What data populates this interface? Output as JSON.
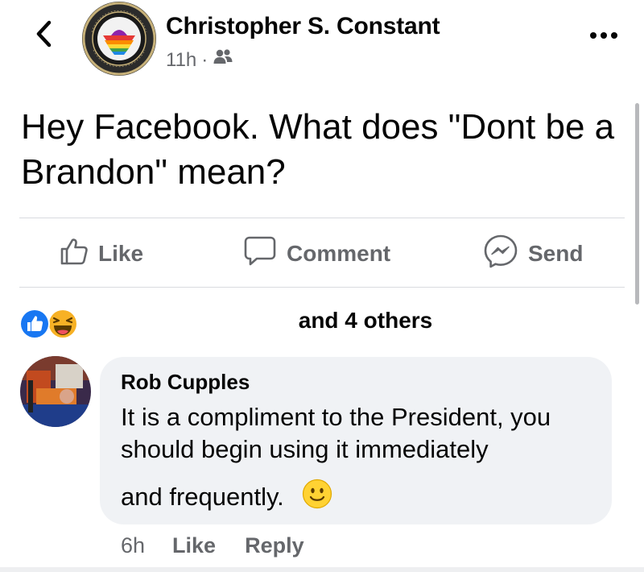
{
  "header": {
    "author": "Christopher S. Constant",
    "time": "11h",
    "separator": "·",
    "audience_icon": "friends-icon",
    "back_icon": "chevron-left-icon",
    "more_icon": "more-horizontal-icon"
  },
  "post": {
    "text": "Hey Facebook. What does \"Dont be a Brandon\"  mean?"
  },
  "actions": {
    "like": "Like",
    "comment": "Comment",
    "send": "Send"
  },
  "reactions": {
    "icons": [
      "like-reaction-icon",
      "haha-reaction-icon"
    ],
    "summary": "and 4 others",
    "colors": {
      "like": "#1877f2",
      "haha": "#f7b125"
    }
  },
  "comment": {
    "author": "Rob Cupples",
    "text": "It is a compliment to the President, you should begin using it immediately",
    "text_last": "and frequently.",
    "emoji": "slightly-smiling-face-icon",
    "time": "6h",
    "like": "Like",
    "reply": "Reply"
  },
  "theme": {
    "text": "#050505",
    "muted": "#65676b",
    "bubble": "#f0f2f5"
  }
}
